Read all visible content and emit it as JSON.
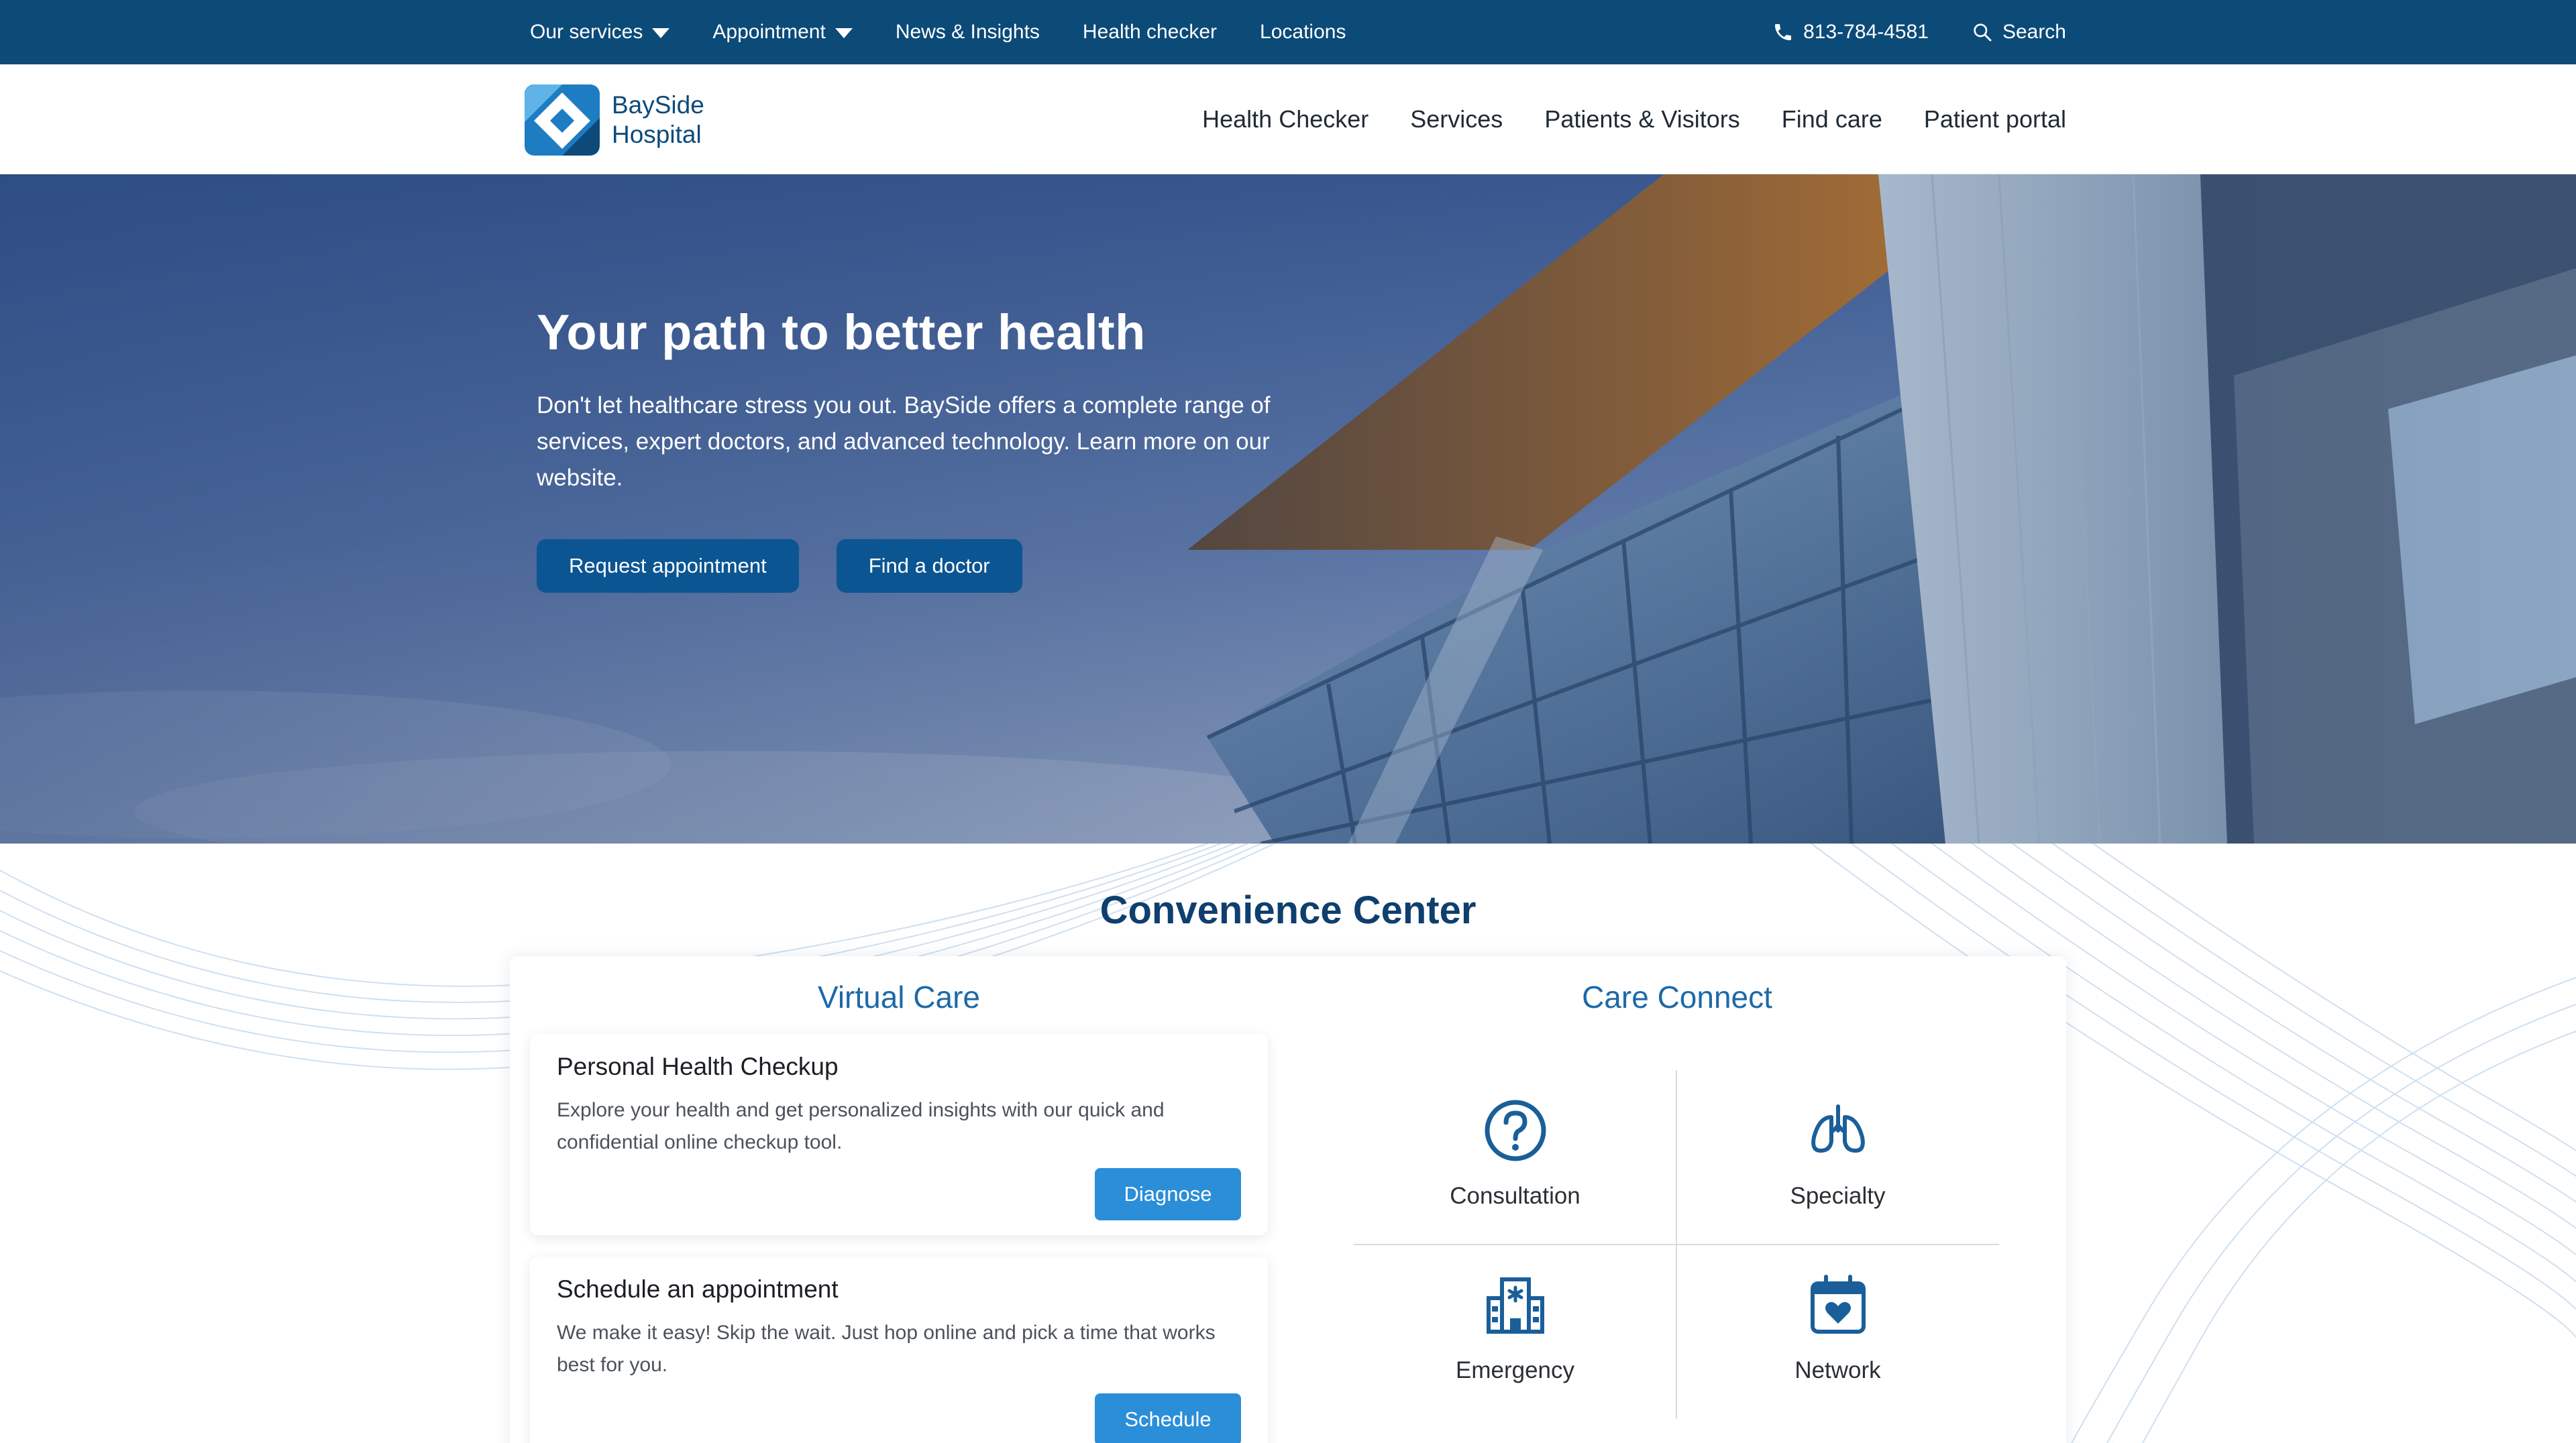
{
  "topbar": {
    "items": [
      {
        "label": "Our services",
        "dropdown": true
      },
      {
        "label": "Appointment",
        "dropdown": true
      },
      {
        "label": "News & Insights"
      },
      {
        "label": "Health checker"
      },
      {
        "label": "Locations"
      }
    ],
    "phone": "813-784-4581",
    "search_label": "Search",
    "phone_icon": "phone-icon",
    "search_icon": "search-icon"
  },
  "brand": {
    "line1": "BaySide",
    "line2": "Hospital",
    "logo_icon": "diamond-logo-icon"
  },
  "mainnav": {
    "items": [
      "Health Checker",
      "Services",
      "Patients & Visitors",
      "Find care",
      "Patient portal"
    ]
  },
  "hero": {
    "title": "Your path to better health",
    "body": "Don't let healthcare stress you out. BaySide offers a complete range of services, expert doctors, and advanced technology. Learn more on our website.",
    "primary_button": "Request appointment",
    "secondary_button": "Find a doctor"
  },
  "convenience": {
    "title": "Convenience Center",
    "virtual_care": {
      "title": "Virtual Care",
      "cards": [
        {
          "title": "Personal Health Checkup",
          "description": "Explore your health and get personalized insights with our quick and confidential online checkup tool.",
          "button": "Diagnose"
        },
        {
          "title": "Schedule an appointment",
          "description": "We make it easy! Skip the wait. Just hop online and pick a time that works best for you.",
          "button": "Schedule"
        }
      ]
    },
    "care_connect": {
      "title": "Care Connect",
      "items": [
        {
          "label": "Consultation",
          "icon": "question-circle-icon"
        },
        {
          "label": "Specialty",
          "icon": "lungs-icon"
        },
        {
          "label": "Emergency",
          "icon": "hospital-building-icon"
        },
        {
          "label": "Network",
          "icon": "calendar-heart-icon"
        }
      ]
    }
  },
  "colors": {
    "topbar_bg": "#0c4a78",
    "brand_blue": "#0d4a7a",
    "hero_button": "#0b5592",
    "card_button": "#2b8ed8",
    "section_title": "#0e3f6e",
    "column_title": "#1d69a8",
    "icon_blue": "#1a5f99"
  }
}
